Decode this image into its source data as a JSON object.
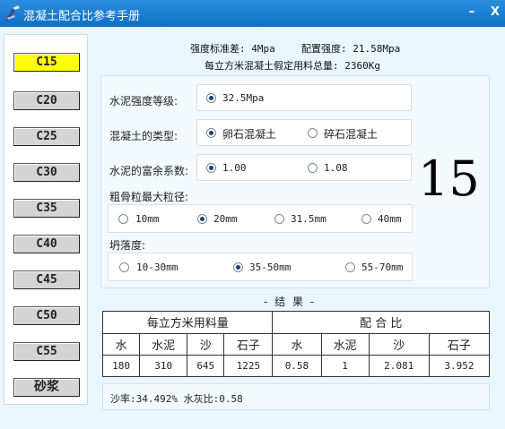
{
  "window": {
    "title": "混凝土配合比参考手册",
    "minimize": "–",
    "close": "X"
  },
  "grades": [
    "C15",
    "C20",
    "C25",
    "C30",
    "C35",
    "C40",
    "C45",
    "C50",
    "C55",
    "砂浆"
  ],
  "selected_grade": "C15",
  "header": {
    "std_dev": "强度标准差: 4Mpa",
    "config_strength": "配置强度: 21.58Mpa",
    "total_weight": "每立方米混凝土假定用料总量: 2360Kg"
  },
  "settings": {
    "cement_grade": {
      "label": "水泥强度等级:",
      "options": [
        "32.5Mpa"
      ],
      "selected": 0
    },
    "concrete_type": {
      "label": "混凝土的类型:",
      "options": [
        "卵石混凝土",
        "碎石混凝土"
      ],
      "selected": 0
    },
    "cement_surplus": {
      "label": "水泥的富余系数:",
      "options": [
        "1.00",
        "1.08"
      ],
      "selected": 0
    },
    "max_aggregate": {
      "label": "粗骨粒最大粒径:",
      "options": [
        "10mm",
        "20mm",
        "31.5mm",
        "40mm"
      ],
      "selected": 1
    },
    "slump": {
      "label": "坍落度:",
      "options": [
        "10-30mm",
        "35-50mm",
        "55-70mm"
      ],
      "selected": 1
    }
  },
  "big_number": "15",
  "results": {
    "title": "- 结 果 -",
    "group_usage": "每立方米用料量",
    "group_ratio": "配 合 比",
    "columns": [
      "水",
      "水泥",
      "沙",
      "石子",
      "水",
      "水泥",
      "沙",
      "石子"
    ],
    "values": [
      "180",
      "310",
      "645",
      "1225",
      "0.58",
      "1",
      "2.081",
      "3.952"
    ]
  },
  "summary": "沙率:34.492% 水灰比:0.58"
}
